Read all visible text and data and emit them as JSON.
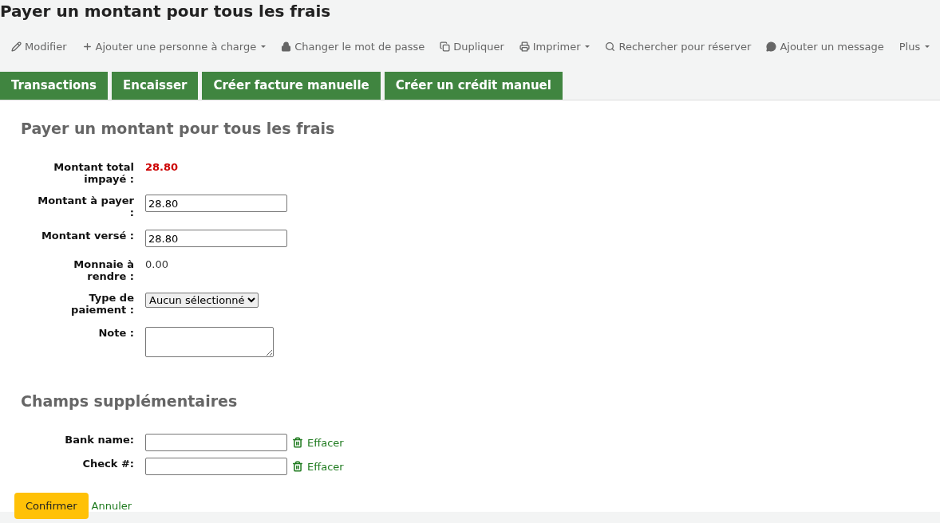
{
  "page_title": "Payer un montant pour tous les frais",
  "toolbar": [
    {
      "label": "Modifier",
      "dropdown": false
    },
    {
      "label": "Ajouter une personne à charge",
      "dropdown": true
    },
    {
      "label": "Changer le mot de passe",
      "dropdown": false
    },
    {
      "label": "Dupliquer",
      "dropdown": false
    },
    {
      "label": "Imprimer",
      "dropdown": true
    },
    {
      "label": "Rechercher pour réserver",
      "dropdown": false
    },
    {
      "label": "Ajouter un message",
      "dropdown": false
    },
    {
      "label": "Plus",
      "dropdown": true
    }
  ],
  "tabs": [
    "Transactions",
    "Encaisser",
    "Créer facture manuelle",
    "Créer un crédit manuel"
  ],
  "form": {
    "heading": "Payer un montant pour tous les frais",
    "rows": [
      {
        "kind": "total",
        "label": "Montant total impayé :",
        "value": "28.80"
      },
      {
        "kind": "input",
        "label": "Montant à payer :",
        "value": "28.80"
      },
      {
        "kind": "input",
        "label": "Montant versé :",
        "value": "28.80"
      },
      {
        "kind": "text",
        "label": "Monnaie à rendre :",
        "value": "0.00"
      },
      {
        "kind": "select",
        "label": "Type de paiement :",
        "value": "Aucun sélectionné"
      },
      {
        "kind": "textarea",
        "label": "Note :"
      }
    ]
  },
  "extra": {
    "heading": "Champs supplémentaires",
    "rows": [
      {
        "label": "Bank name:",
        "clear": "Effacer"
      },
      {
        "label": "Check #:",
        "clear": "Effacer"
      }
    ]
  },
  "actions": {
    "confirm": "Confirmer",
    "cancel": "Annuler"
  }
}
